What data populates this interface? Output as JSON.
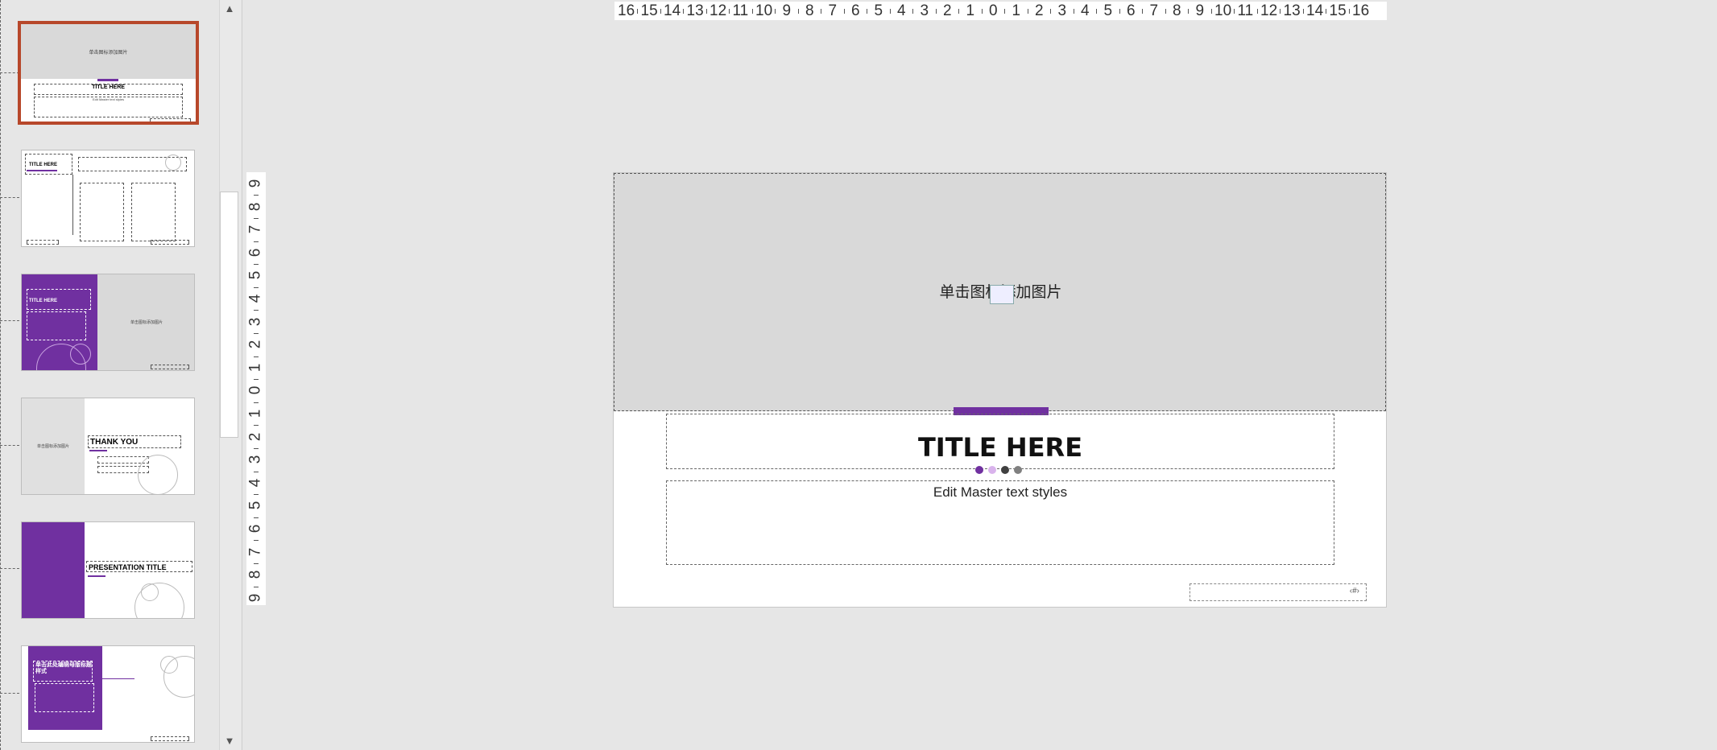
{
  "thumbnails": {
    "image_placeholder_small": "单击图标添加图片",
    "t1_title": "TITLE HERE",
    "t1_sub": "Edit Master text styles",
    "t2_title": "TITLE HERE",
    "t3_title": "TITLE HERE",
    "t4_title": "THANK YOU",
    "t5_title": "PRESENTATION TITLE",
    "t6_title": "单击此处编辑母版标题样式"
  },
  "ruler": {
    "horizontal": [
      "16",
      "15",
      "14",
      "13",
      "12",
      "11",
      "10",
      "9",
      "8",
      "7",
      "6",
      "5",
      "4",
      "3",
      "2",
      "1",
      "0",
      "1",
      "2",
      "3",
      "4",
      "5",
      "6",
      "7",
      "8",
      "9",
      "10",
      "11",
      "12",
      "13",
      "14",
      "15",
      "16"
    ],
    "vertical": [
      "9",
      "8",
      "7",
      "6",
      "5",
      "4",
      "3",
      "2",
      "1",
      "0",
      "1",
      "2",
      "3",
      "4",
      "5",
      "6",
      "7",
      "8",
      "9"
    ]
  },
  "slide": {
    "image_placeholder": "单击图标添加图片",
    "title": "TITLE HERE",
    "body": "Edit Master text styles",
    "page_number": "‹#›"
  },
  "colors": {
    "accent": "#7030a0",
    "selection": "#b7472a",
    "dots": [
      "#7030a0",
      "#d9b3ec",
      "#404040",
      "#808080"
    ]
  },
  "scroll": {
    "up_icon": "▲",
    "down_icon": "▼"
  }
}
